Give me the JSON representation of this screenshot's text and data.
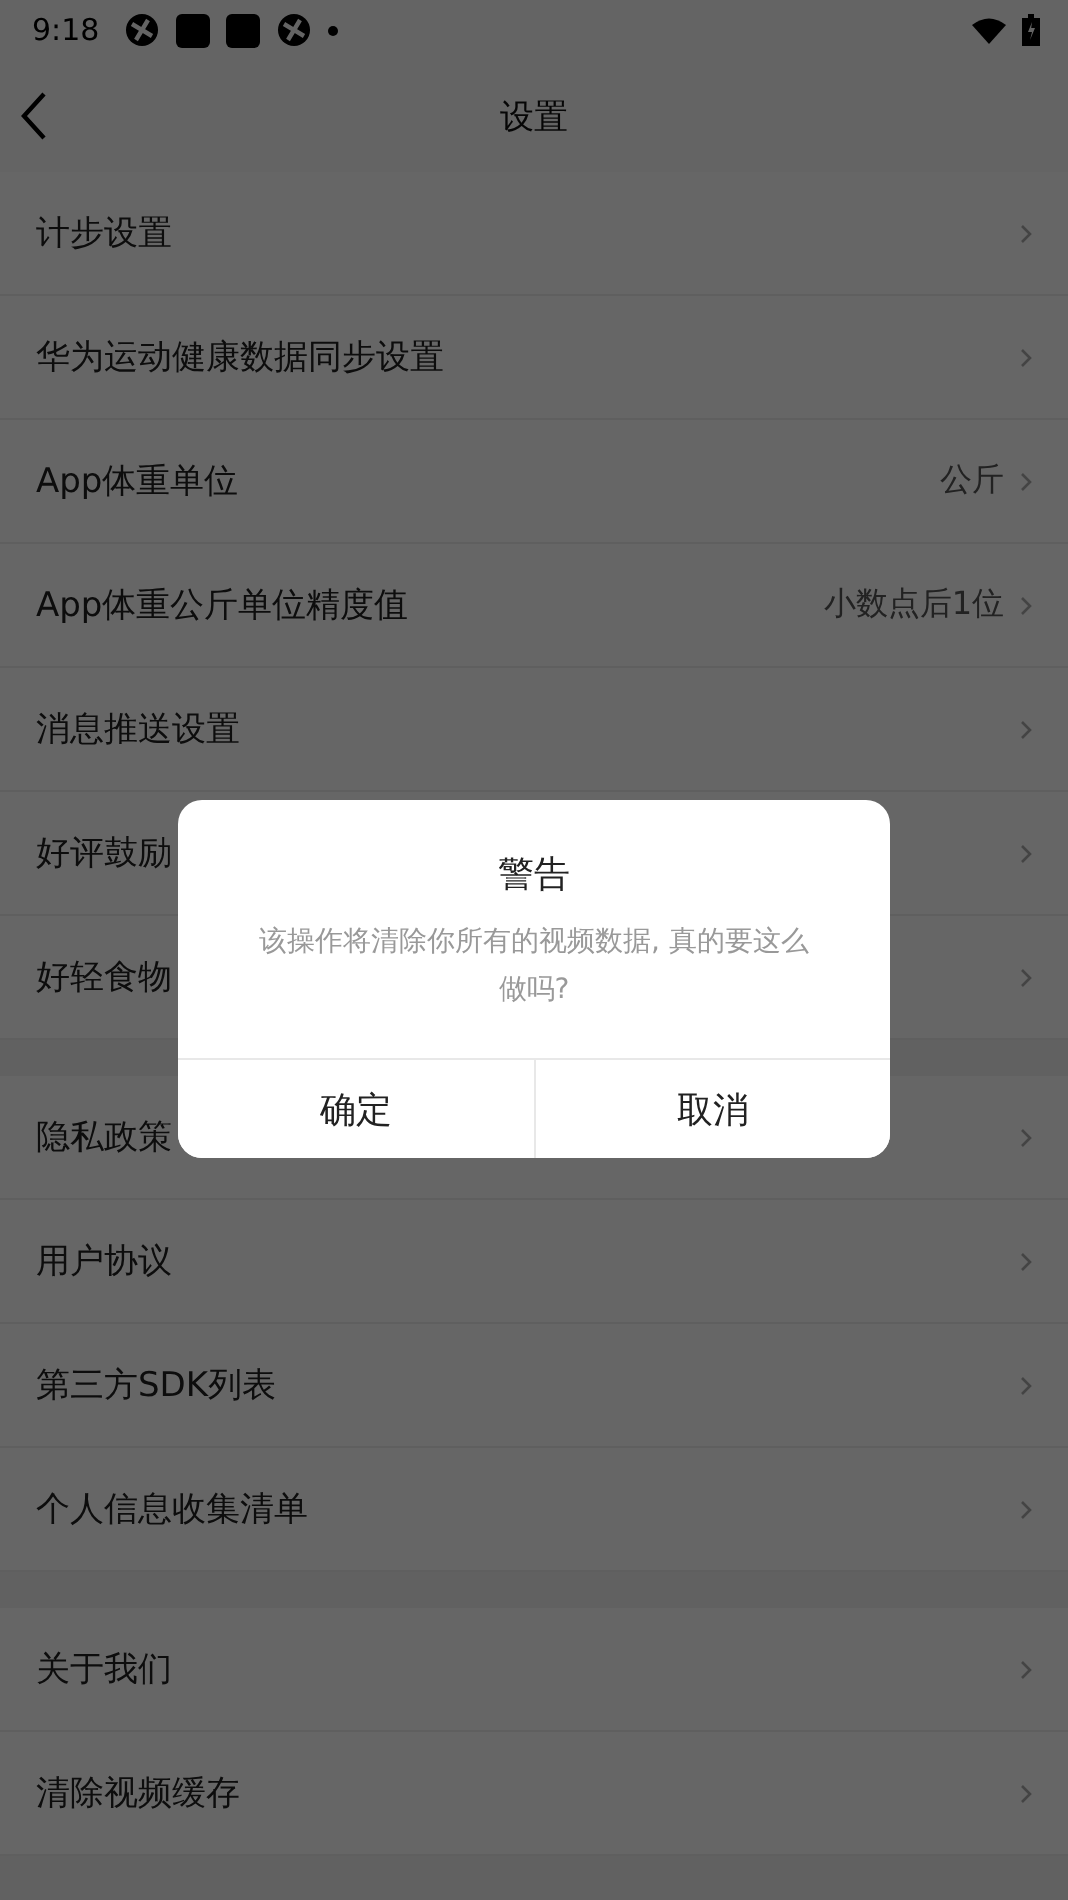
{
  "status_bar": {
    "time": "9:18"
  },
  "header": {
    "title": "设置"
  },
  "groups": [
    {
      "rows": [
        {
          "label": "计步设置"
        },
        {
          "label": "华为运动健康数据同步设置"
        },
        {
          "label": "App体重单位",
          "value": "公斤"
        },
        {
          "label": "App体重公斤单位精度值",
          "value": "小数点后1位"
        },
        {
          "label": "消息推送设置"
        },
        {
          "label": "好评鼓励"
        },
        {
          "label": "好轻食物"
        }
      ]
    },
    {
      "rows": [
        {
          "label": "隐私政策"
        },
        {
          "label": "用户协议"
        },
        {
          "label": "第三方SDK列表"
        },
        {
          "label": "个人信息收集清单"
        }
      ]
    },
    {
      "rows": [
        {
          "label": "关于我们"
        },
        {
          "label": "清除视频缓存"
        }
      ]
    }
  ],
  "dialog": {
    "title": "警告",
    "message": "该操作将清除你所有的视频数据, 真的要这么做吗?",
    "buttons": [
      "确定",
      "取消"
    ]
  }
}
